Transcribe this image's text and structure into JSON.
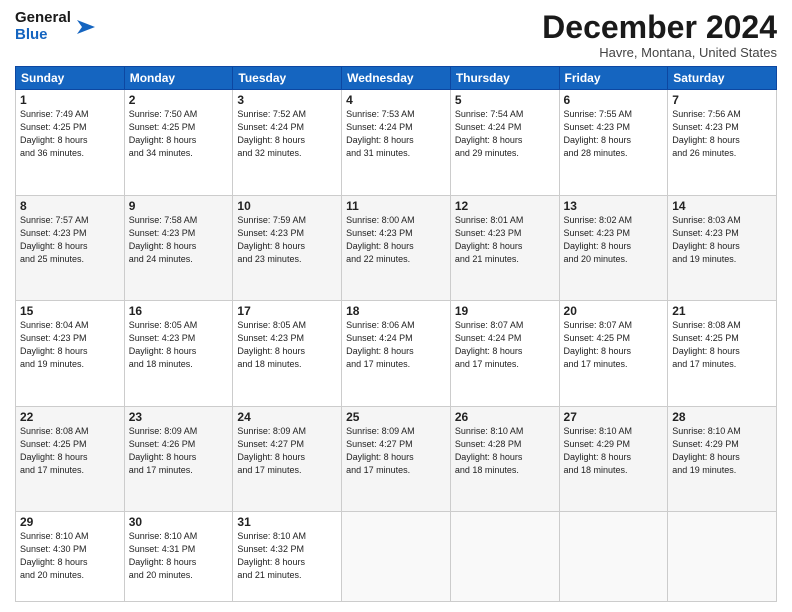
{
  "header": {
    "logo_line1": "General",
    "logo_line2": "Blue",
    "month": "December 2024",
    "location": "Havre, Montana, United States"
  },
  "days_of_week": [
    "Sunday",
    "Monday",
    "Tuesday",
    "Wednesday",
    "Thursday",
    "Friday",
    "Saturday"
  ],
  "weeks": [
    [
      {
        "day": "1",
        "info": "Sunrise: 7:49 AM\nSunset: 4:25 PM\nDaylight: 8 hours\nand 36 minutes."
      },
      {
        "day": "2",
        "info": "Sunrise: 7:50 AM\nSunset: 4:25 PM\nDaylight: 8 hours\nand 34 minutes."
      },
      {
        "day": "3",
        "info": "Sunrise: 7:52 AM\nSunset: 4:24 PM\nDaylight: 8 hours\nand 32 minutes."
      },
      {
        "day": "4",
        "info": "Sunrise: 7:53 AM\nSunset: 4:24 PM\nDaylight: 8 hours\nand 31 minutes."
      },
      {
        "day": "5",
        "info": "Sunrise: 7:54 AM\nSunset: 4:24 PM\nDaylight: 8 hours\nand 29 minutes."
      },
      {
        "day": "6",
        "info": "Sunrise: 7:55 AM\nSunset: 4:23 PM\nDaylight: 8 hours\nand 28 minutes."
      },
      {
        "day": "7",
        "info": "Sunrise: 7:56 AM\nSunset: 4:23 PM\nDaylight: 8 hours\nand 26 minutes."
      }
    ],
    [
      {
        "day": "8",
        "info": "Sunrise: 7:57 AM\nSunset: 4:23 PM\nDaylight: 8 hours\nand 25 minutes."
      },
      {
        "day": "9",
        "info": "Sunrise: 7:58 AM\nSunset: 4:23 PM\nDaylight: 8 hours\nand 24 minutes."
      },
      {
        "day": "10",
        "info": "Sunrise: 7:59 AM\nSunset: 4:23 PM\nDaylight: 8 hours\nand 23 minutes."
      },
      {
        "day": "11",
        "info": "Sunrise: 8:00 AM\nSunset: 4:23 PM\nDaylight: 8 hours\nand 22 minutes."
      },
      {
        "day": "12",
        "info": "Sunrise: 8:01 AM\nSunset: 4:23 PM\nDaylight: 8 hours\nand 21 minutes."
      },
      {
        "day": "13",
        "info": "Sunrise: 8:02 AM\nSunset: 4:23 PM\nDaylight: 8 hours\nand 20 minutes."
      },
      {
        "day": "14",
        "info": "Sunrise: 8:03 AM\nSunset: 4:23 PM\nDaylight: 8 hours\nand 19 minutes."
      }
    ],
    [
      {
        "day": "15",
        "info": "Sunrise: 8:04 AM\nSunset: 4:23 PM\nDaylight: 8 hours\nand 19 minutes."
      },
      {
        "day": "16",
        "info": "Sunrise: 8:05 AM\nSunset: 4:23 PM\nDaylight: 8 hours\nand 18 minutes."
      },
      {
        "day": "17",
        "info": "Sunrise: 8:05 AM\nSunset: 4:23 PM\nDaylight: 8 hours\nand 18 minutes."
      },
      {
        "day": "18",
        "info": "Sunrise: 8:06 AM\nSunset: 4:24 PM\nDaylight: 8 hours\nand 17 minutes."
      },
      {
        "day": "19",
        "info": "Sunrise: 8:07 AM\nSunset: 4:24 PM\nDaylight: 8 hours\nand 17 minutes."
      },
      {
        "day": "20",
        "info": "Sunrise: 8:07 AM\nSunset: 4:25 PM\nDaylight: 8 hours\nand 17 minutes."
      },
      {
        "day": "21",
        "info": "Sunrise: 8:08 AM\nSunset: 4:25 PM\nDaylight: 8 hours\nand 17 minutes."
      }
    ],
    [
      {
        "day": "22",
        "info": "Sunrise: 8:08 AM\nSunset: 4:25 PM\nDaylight: 8 hours\nand 17 minutes."
      },
      {
        "day": "23",
        "info": "Sunrise: 8:09 AM\nSunset: 4:26 PM\nDaylight: 8 hours\nand 17 minutes."
      },
      {
        "day": "24",
        "info": "Sunrise: 8:09 AM\nSunset: 4:27 PM\nDaylight: 8 hours\nand 17 minutes."
      },
      {
        "day": "25",
        "info": "Sunrise: 8:09 AM\nSunset: 4:27 PM\nDaylight: 8 hours\nand 17 minutes."
      },
      {
        "day": "26",
        "info": "Sunrise: 8:10 AM\nSunset: 4:28 PM\nDaylight: 8 hours\nand 18 minutes."
      },
      {
        "day": "27",
        "info": "Sunrise: 8:10 AM\nSunset: 4:29 PM\nDaylight: 8 hours\nand 18 minutes."
      },
      {
        "day": "28",
        "info": "Sunrise: 8:10 AM\nSunset: 4:29 PM\nDaylight: 8 hours\nand 19 minutes."
      }
    ],
    [
      {
        "day": "29",
        "info": "Sunrise: 8:10 AM\nSunset: 4:30 PM\nDaylight: 8 hours\nand 20 minutes."
      },
      {
        "day": "30",
        "info": "Sunrise: 8:10 AM\nSunset: 4:31 PM\nDaylight: 8 hours\nand 20 minutes."
      },
      {
        "day": "31",
        "info": "Sunrise: 8:10 AM\nSunset: 4:32 PM\nDaylight: 8 hours\nand 21 minutes."
      },
      {
        "day": "",
        "info": ""
      },
      {
        "day": "",
        "info": ""
      },
      {
        "day": "",
        "info": ""
      },
      {
        "day": "",
        "info": ""
      }
    ]
  ]
}
